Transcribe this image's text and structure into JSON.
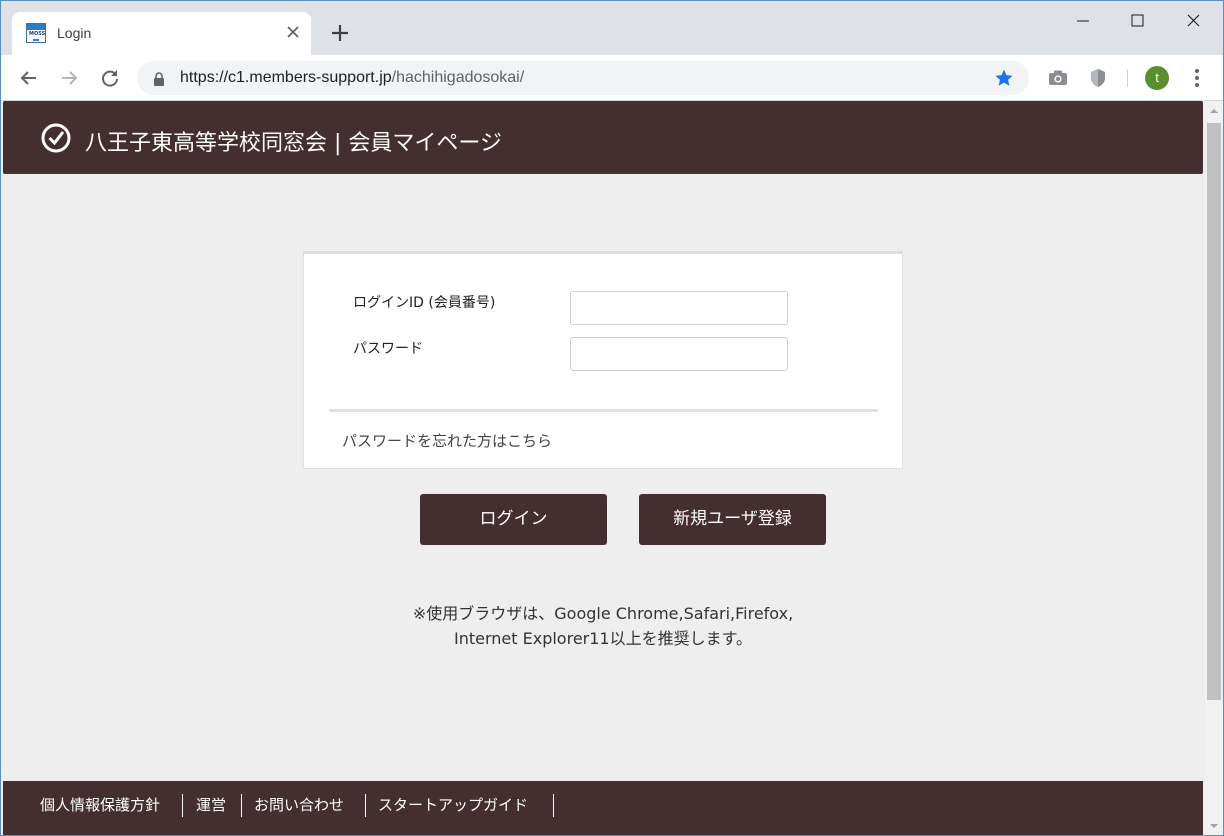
{
  "browser": {
    "tab_title": "Login",
    "favicon_text": "MOSS",
    "url_host": "https://c1.members-support.jp",
    "url_path": "/hachihigadosokai/",
    "avatar_letter": "t",
    "colors": {
      "star": "#1a73e8",
      "avatar": "#5b8f2e"
    }
  },
  "header": {
    "title": "八王子東高等学校同窓会 | 会員マイページ",
    "logo_icon": "check-circle-icon",
    "color": "#452e2f"
  },
  "login_form": {
    "id_label": "ログインID (会員番号)",
    "id_value": "",
    "password_label": "パスワード",
    "password_value": "",
    "forgot_link": "パスワードを忘れた方はこちら"
  },
  "buttons": {
    "login": "ログイン",
    "register": "新規ユーザ登録"
  },
  "notice": {
    "line1": "※使用ブラウザは、Google Chrome,Safari,Firefox,",
    "line2": "Internet Explorer11以上を推奨します。"
  },
  "footer": {
    "links": [
      "個人情報保護方針",
      "運営",
      "お問い合わせ",
      "スタートアップガイド"
    ]
  }
}
